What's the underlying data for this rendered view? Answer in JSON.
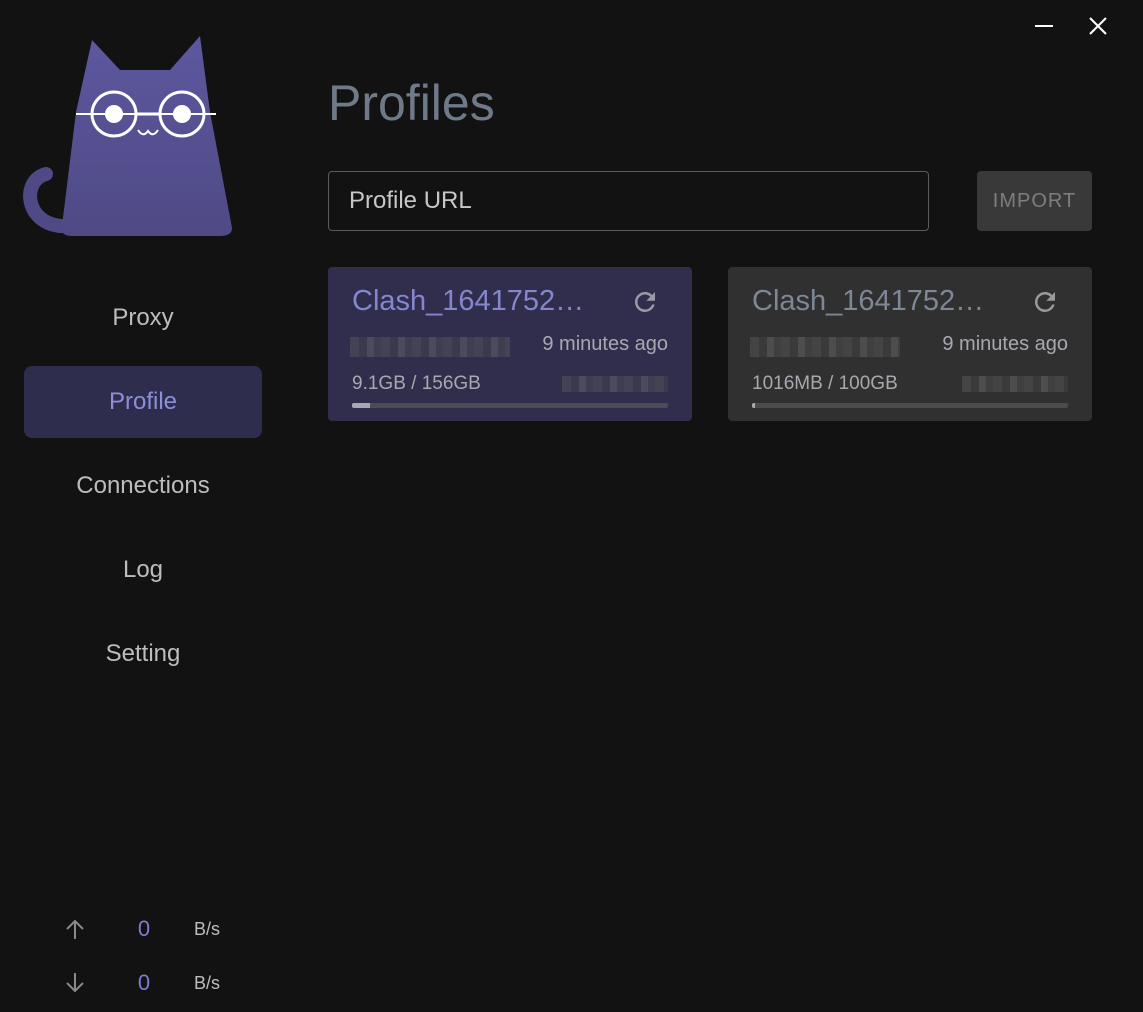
{
  "window": {
    "minimize_icon": "minimize-icon",
    "close_icon": "close-icon"
  },
  "sidebar": {
    "logo_icon": "cat-logo-icon",
    "nav": [
      {
        "label": "Proxy",
        "active": false
      },
      {
        "label": "Profile",
        "active": true
      },
      {
        "label": "Connections",
        "active": false
      },
      {
        "label": "Log",
        "active": false
      },
      {
        "label": "Setting",
        "active": false
      }
    ],
    "traffic": {
      "upload": {
        "value": "0",
        "unit": "B/s",
        "icon": "arrow-up-icon"
      },
      "download": {
        "value": "0",
        "unit": "B/s",
        "icon": "arrow-down-icon"
      }
    }
  },
  "main": {
    "title": "Profiles",
    "url_input": {
      "placeholder": "Profile URL",
      "value": ""
    },
    "import_button": "IMPORT",
    "profiles": [
      {
        "name": "Clash_1641752…",
        "updated": "9 minutes ago",
        "usage": "9.1GB / 156GB",
        "usage_fraction": 0.058,
        "selected": true,
        "refresh_icon": "refresh-icon"
      },
      {
        "name": "Clash_1641752…",
        "updated": "9 minutes ago",
        "usage": "1016MB / 100GB",
        "usage_fraction": 0.01,
        "selected": false,
        "refresh_icon": "refresh-icon"
      }
    ]
  },
  "colors": {
    "background": "#121212",
    "accent": "#8e8ed8",
    "selected_card": "#302e4c",
    "card": "#303030",
    "nav_active": "#2f2d4d",
    "logo": "#5b579a"
  }
}
